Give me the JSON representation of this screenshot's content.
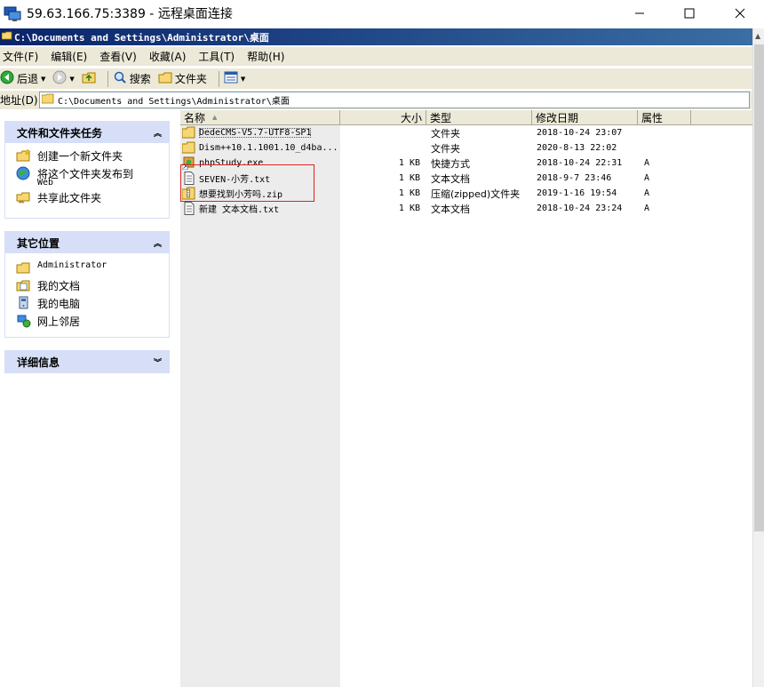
{
  "rdp": {
    "title": "59.63.166.75:3389 - 远程桌面连接",
    "minimize_glyph": "—",
    "maximize_glyph": "☐",
    "close_glyph": "✕"
  },
  "explorer": {
    "title": "C:\\Documents and Settings\\Administrator\\桌面"
  },
  "menu": {
    "items": [
      "文件(F)",
      "编辑(E)",
      "查看(V)",
      "收藏(A)",
      "工具(T)",
      "帮助(H)"
    ]
  },
  "toolbar": {
    "back_label": "后退",
    "search_label": "搜索",
    "folders_label": "文件夹"
  },
  "address": {
    "label": "地址(D)",
    "value": "C:\\Documents and Settings\\Administrator\\桌面"
  },
  "taskpane": {
    "file_tasks": {
      "title": "文件和文件夹任务",
      "items": [
        "创建一个新文件夹",
        "将这个文件夹发布到",
        "Web",
        "共享此文件夹"
      ]
    },
    "other_places": {
      "title": "其它位置",
      "items": [
        "Administrator",
        "我的文档",
        "我的电脑",
        "网上邻居"
      ]
    },
    "details": {
      "title": "详细信息"
    }
  },
  "columns": {
    "name": "名称",
    "size": "大小",
    "type": "类型",
    "modified": "修改日期",
    "attributes": "属性"
  },
  "files": [
    {
      "name": "DedeCMS-V5.7-UTF8-SP1",
      "size": "",
      "type": "文件夹",
      "modified": "2018-10-24 23:07",
      "attr": "",
      "icon": "folder-icon"
    },
    {
      "name": "Dism++10.1.1001.10_d4ba...",
      "size": "",
      "type": "文件夹",
      "modified": "2020-8-13 22:02",
      "attr": "",
      "icon": "folder-icon"
    },
    {
      "name": "phpStudy.exe",
      "size": "1 KB",
      "type": "快捷方式",
      "modified": "2018-10-24 22:31",
      "attr": "A",
      "icon": "shortcut-icon"
    },
    {
      "name": "SEVEN-小芳.txt",
      "size": "1 KB",
      "type": "文本文档",
      "modified": "2018-9-7 23:46",
      "attr": "A",
      "icon": "text-file-icon"
    },
    {
      "name": "想要找到小芳吗.zip",
      "size": "1 KB",
      "type": "压缩(zipped)文件夹",
      "modified": "2019-1-16 19:54",
      "attr": "A",
      "icon": "zip-folder-icon"
    },
    {
      "name": "新建 文本文档.txt",
      "size": "1 KB",
      "type": "文本文档",
      "modified": "2018-10-24 23:24",
      "attr": "A",
      "icon": "text-file-icon"
    }
  ],
  "colors": {
    "title_bar": "#0a246a",
    "panel_header": "#d6dff7",
    "highlight_box": "#e02020",
    "chrome": "#ece9d8"
  }
}
